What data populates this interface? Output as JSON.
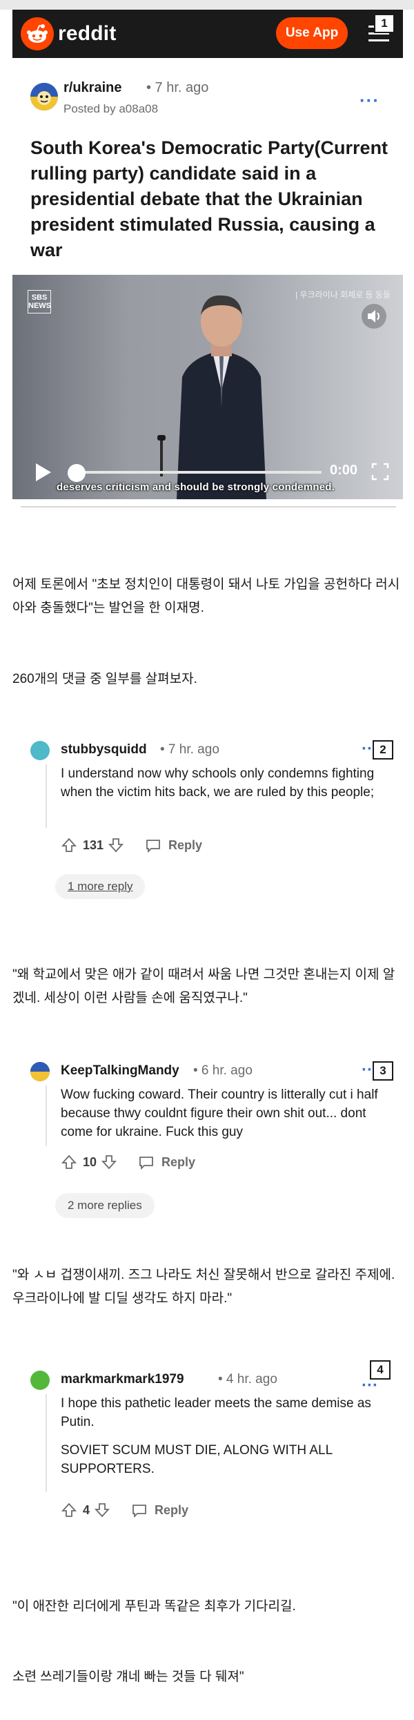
{
  "header": {
    "brand": "reddit",
    "use_app": "Use App",
    "marker": "1"
  },
  "post": {
    "subreddit": "r/ukraine",
    "time": "• 7 hr. ago",
    "posted_by": "Posted by a08a08",
    "title": "South Korea's Democratic Party(Current rulling party) candidate said in a presidential debate that the Ukrainian president stimulated Russia, causing a war"
  },
  "video": {
    "channel": "SBS NEWS",
    "corner_label": "| 우크라이나 회체로 등 동들",
    "time": "0:00",
    "caption": "deserves criticism and should be strongly condemned."
  },
  "body_text": {
    "intro": "어제 토론에서 \"초보 정치인이 대통령이 돼서 나토 가입을 공헌하다 러시아와 충돌했다\"는 발언을 한 이재명.",
    "lead": "260개의 댓글 중 일부를 살펴보자.",
    "trans1": "\"왜 학교에서 맞은 애가 같이 때려서 싸움 나면 그것만 혼내는지 이제 알겠네. 세상이 이런 사람들 손에 움직였구나.\"",
    "trans2": "\"와 ㅅㅂ 겁쟁이새끼. 즈그 나라도 처신 잘못해서 반으로 갈라진 주제에. 우크라이나에 발 디딜 생각도 하지 마라.\"",
    "trans3a": "\"이 애잔한 리더에게 푸틴과 똑같은 최후가 기다리길.",
    "trans3b": "소련 쓰레기들이랑 걔네 빠는 것들 다 뒈져\""
  },
  "comments": [
    {
      "user": "stubbysquidd",
      "time": "• 7 hr. ago",
      "marker": "2",
      "text": "I understand now why schools only condemns fighting when the victim hits back, we are ruled by this people;",
      "votes": "131",
      "reply_label": "Reply",
      "more": "1 more reply"
    },
    {
      "user": "KeepTalkingMandy",
      "time": "• 6 hr. ago",
      "marker": "3",
      "text": "Wow fucking coward. Their country is litterally cut i half because thwy couldnt figure their own shit out... dont come for ukraine. Fuck this guy",
      "votes": "10",
      "reply_label": "Reply",
      "more": "2 more replies"
    },
    {
      "user": "markmarkmark1979",
      "time": "• 4 hr. ago",
      "marker": "4",
      "text1": "I hope this pathetic leader meets the same demise as Putin.",
      "text2": "SOVIET SCUM MUST DIE, ALONG WITH ALL SUPPORTERS.",
      "votes": "4",
      "reply_label": "Reply"
    }
  ],
  "colors": {
    "brand_orange": "#ff4500",
    "header_bg": "#1a1a1b",
    "link_blue": "#3a6fd8"
  }
}
